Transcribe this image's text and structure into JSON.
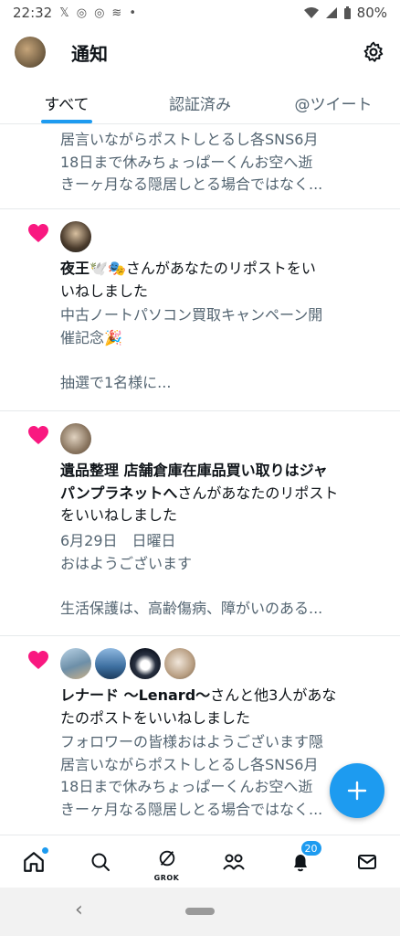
{
  "status_bar": {
    "time": "22:32",
    "battery": "80%"
  },
  "header": {
    "title": "通知"
  },
  "tabs": [
    {
      "label": "すべて",
      "active": true
    },
    {
      "label": "認証済み",
      "active": false
    },
    {
      "label": "@ツイート",
      "active": false
    }
  ],
  "notifications": [
    {
      "snippet_lines": [
        "居言いながらポストしとるし各SNS6月",
        "18日まで休みちょっぱーくんお空へ逝",
        "きーヶ月なる隠居しとる場合ではなく..."
      ]
    },
    {
      "user": "夜王",
      "user_emoji": "🕊️🎭",
      "action_line1": "さんがあなたのリポストをい",
      "action_line2": "いねしました",
      "snippet_lines": [
        "中古ノートパソコン買取キャンペーン開",
        "催記念🎉",
        "",
        "抽選で1名様に..."
      ]
    },
    {
      "user_line1": "遺品整理 店舗倉庫在庫品買い取りはジャ",
      "user_line2": "パンプラネットへ",
      "action_line2": "さんがあなたのリポスト",
      "action_line3": "をいいねしました",
      "snippet_lines": [
        "6月29日　日曜日",
        "おはようございます",
        "",
        "生活保護は、高齢傷病、障がいのある..."
      ]
    },
    {
      "user": "レナード 〜Lenard〜",
      "action_line1": "さんと他3人があな",
      "action_line2": "たのポストをいいねしました",
      "snippet_lines": [
        "フォロワーの皆様おはようございます隠",
        "居言いながらポストしとるし各SNS6月",
        "18日まで休みちょっぱーくんお空へ逝",
        "きーヶ月なる隠居しとる場合ではなく..."
      ]
    }
  ],
  "bottom_nav": {
    "grok_label": "GROK",
    "notifications_badge": "20"
  },
  "icons": {
    "heart_color": "#f91880",
    "accent": "#1d9bf0"
  }
}
